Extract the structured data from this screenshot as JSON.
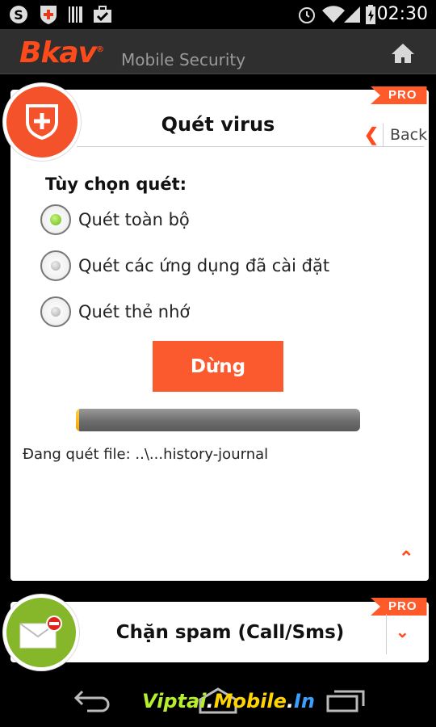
{
  "status_bar": {
    "time": "02:30",
    "icons": [
      "skype-icon",
      "bkav-shield-icon",
      "barcode-icon",
      "briefcase-check-icon",
      "alarm-icon",
      "wifi-icon",
      "signal-icon",
      "battery-charging-icon"
    ]
  },
  "app_bar": {
    "logo": "Bkav",
    "logo_mark": "®",
    "app_name": "Mobile Security",
    "home_icon": "home-icon"
  },
  "scan_card": {
    "badge": "PRO",
    "title": "Quét virus",
    "back_label": "Back",
    "options_heading": "Tùy chọn quét:",
    "options": [
      {
        "label": "Quét toàn bộ",
        "selected": true
      },
      {
        "label": "Quét các ứng dụng đã cài đặt",
        "selected": false
      },
      {
        "label": "Quét thẻ nhớ",
        "selected": false
      }
    ],
    "stop_label": "Dừng",
    "progress_fraction": 0.01,
    "status_text": "Đang quét file: ..\\...history-journal",
    "accent": "#fb5a2e"
  },
  "spam_card": {
    "badge": "PRO",
    "title": "Chặn spam (Call/Sms)",
    "accent": "#86b62a"
  },
  "watermark": {
    "parts": [
      {
        "text": "Viptai",
        "color": "#b6f02c"
      },
      {
        "text": ".",
        "color": "#ffffff"
      },
      {
        "text": "Mobile",
        "color": "#ffd400"
      },
      {
        "text": ".",
        "color": "#ffffff"
      },
      {
        "text": "In",
        "color": "#3aa0ff"
      }
    ]
  }
}
